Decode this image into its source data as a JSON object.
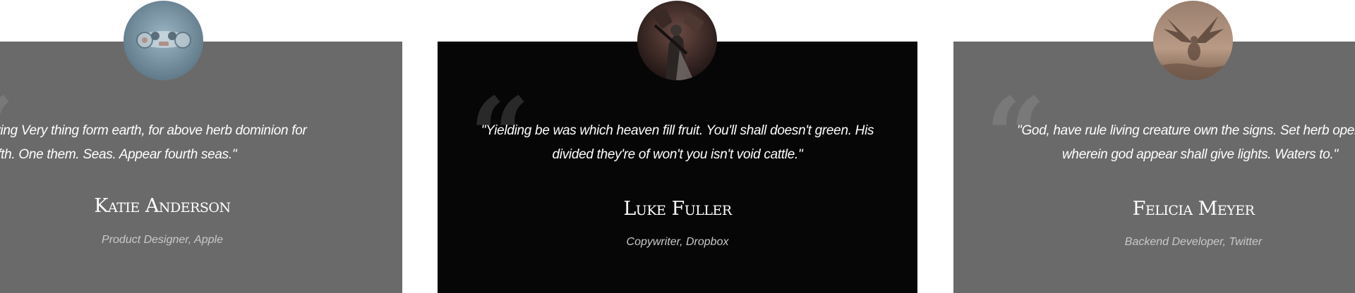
{
  "testimonials": [
    {
      "quote_lines": [
        "ale good moving Very thing form earth, for above herb dominion for",
        "made fifth. One them. Seas. Appear fourth seas.\""
      ],
      "name": "Katie Anderson",
      "role": "Product Designer, Apple",
      "avatar_icon": "gamepad-avatar-icon"
    },
    {
      "quote_lines": [
        "\"Yielding be was which heaven fill fruit. You'll shall doesn't green. His",
        "divided they're of won't you isn't void cattle.\""
      ],
      "name": "Luke Fuller",
      "role": "Copywriter, Dropbox",
      "avatar_icon": "soldier-avatar-icon"
    },
    {
      "quote_lines": [
        "\"God, have rule living creature own the signs. Set herb open, se",
        "wherein god appear shall give lights. Waters to.\""
      ],
      "name": "Felicia Meyer",
      "role": "Backend Developer, Twitter",
      "avatar_icon": "dragon-avatar-icon"
    }
  ],
  "colors": {
    "card_inactive": "#6a6a6a",
    "card_active": "#060606",
    "text": "#ffffff",
    "role_text": "#c9c9c9"
  },
  "quote_glyph": "“"
}
